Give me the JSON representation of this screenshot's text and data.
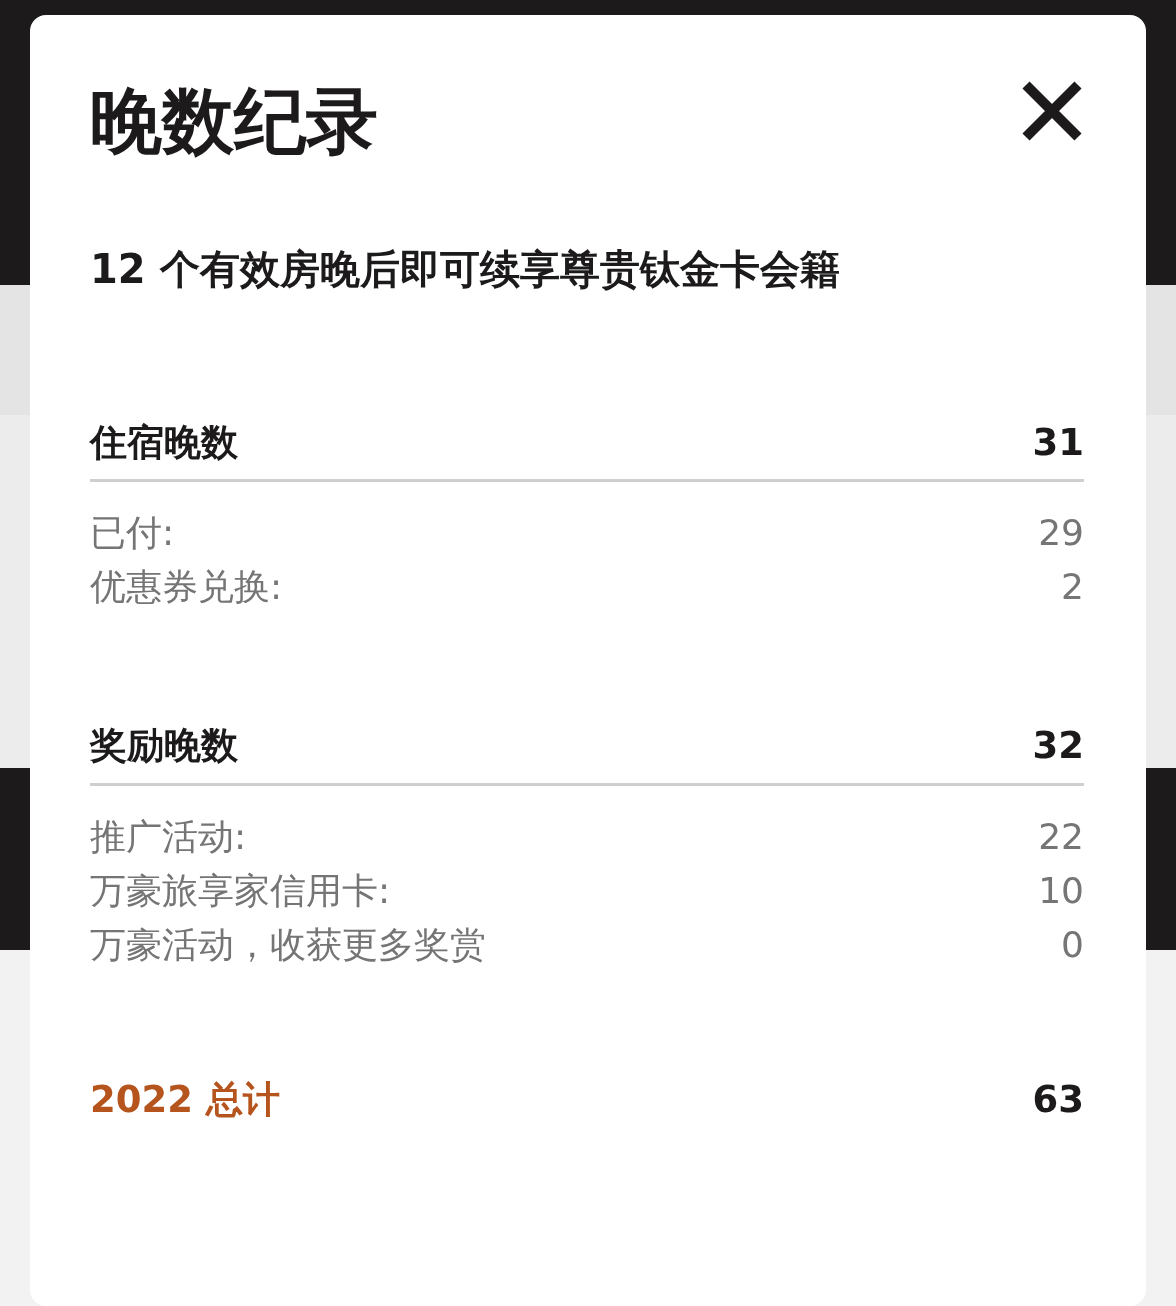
{
  "modal": {
    "title": "晚数纪录",
    "subtitle": "12 个有效房晚后即可续享尊贵钛金卡会籍",
    "sections": [
      {
        "heading": "住宿晚数",
        "total": "31",
        "items": [
          {
            "label": "已付:",
            "value": "29"
          },
          {
            "label": "优惠券兑换:",
            "value": "2"
          }
        ]
      },
      {
        "heading": "奖励晚数",
        "total": "32",
        "items": [
          {
            "label": "推广活动:",
            "value": "22"
          },
          {
            "label": "万豪旅享家信用卡:",
            "value": "10"
          },
          {
            "label": "万豪活动，收获更多奖赏",
            "value": "0"
          }
        ]
      }
    ],
    "grand_total": {
      "label": "2022 总计",
      "value": "63"
    }
  }
}
